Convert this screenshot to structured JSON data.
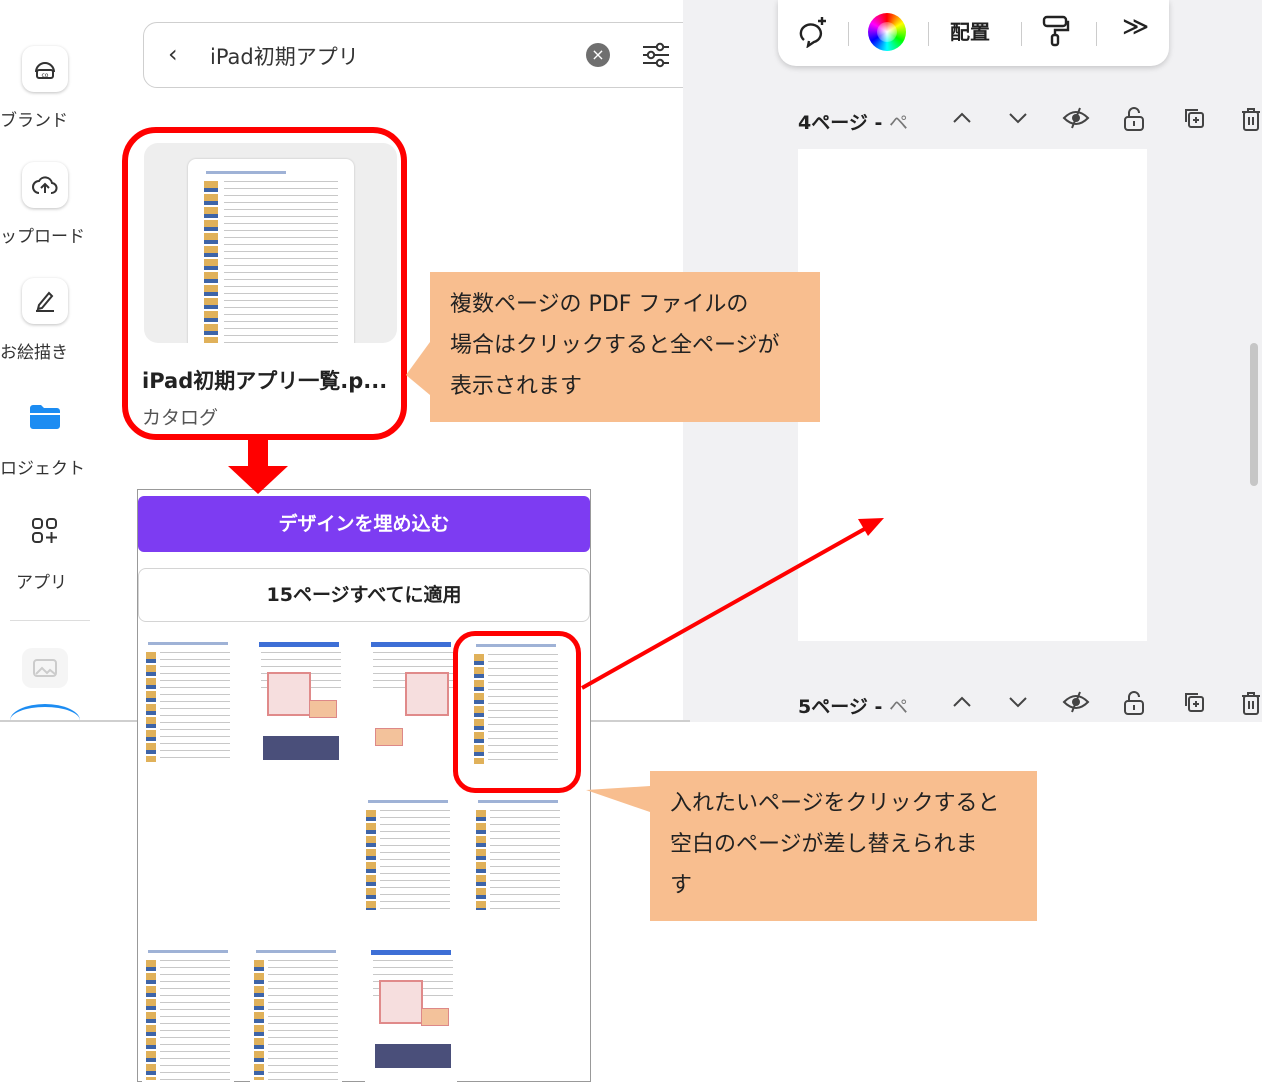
{
  "sidebar": {
    "items": [
      {
        "label": "ブランド",
        "icon": "brand-icon"
      },
      {
        "label": "ップロード",
        "icon": "upload-cloud-icon"
      },
      {
        "label": "お絵描き",
        "icon": "draw-icon"
      },
      {
        "label": "ロジェクト",
        "icon": "folder-icon"
      },
      {
        "label": "アプリ",
        "icon": "apps-icon"
      }
    ]
  },
  "search": {
    "back_icon": "chevron-left-icon",
    "query": "iPad初期アプリ",
    "clear_icon": "clear-icon",
    "filter_icon": "filter-icon"
  },
  "file_card": {
    "name": "iPad初期アプリ一覧.p...",
    "type": "カタログ"
  },
  "pages_panel": {
    "embed_button": "デザインを埋め込む",
    "apply_button": "15ページすべてに適用"
  },
  "toolbar": {
    "arrange_label": "配置",
    "more_label": "≫"
  },
  "pages": [
    {
      "label": "4ページ - ",
      "name": "ペ"
    },
    {
      "label": "5ページ - ",
      "name": "ペ"
    }
  ],
  "callouts": {
    "callout1_lines": [
      "複数ページの PDF ファイルの",
      "場合はクリックすると全ページが",
      "表示されます"
    ],
    "callout2_lines": [
      "入れたいページをクリックすると",
      "空白のページが差し替えられま",
      "す"
    ]
  },
  "colors": {
    "annotation_red": "#ff0000",
    "callout_fill": "#f8be8f",
    "embed_purple": "#7d3cf2"
  }
}
